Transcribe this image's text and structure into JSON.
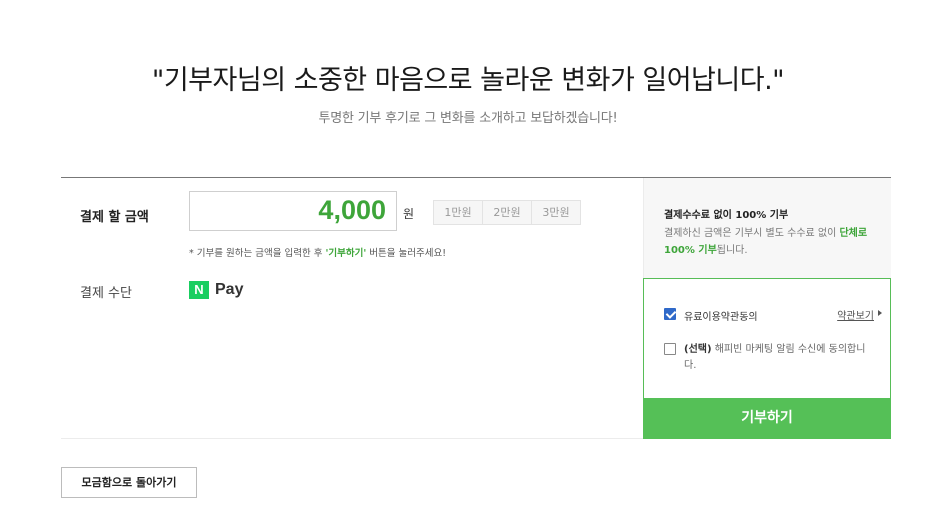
{
  "hero": {
    "title": "\"기부자님의 소중한 마음으로 놀라운 변화가 일어납니다.\"",
    "subtitle": "투명한 기부 후기로 그 변화를 소개하고 보답하겠습니다!"
  },
  "form": {
    "amount_label": "결제 할 금액",
    "amount_value": "4,000",
    "unit": "원",
    "quick_amounts": [
      "1만원",
      "2만원",
      "3만원"
    ],
    "hint_prefix": "* 기부를 원하는 금액을 입력한 후 ",
    "hint_highlight": "'기부하기'",
    "hint_suffix": " 버튼을 눌러주세요!",
    "method_label": "결제 수단",
    "method_logo_letter": "N",
    "method_logo_text": "Pay"
  },
  "fee": {
    "title": "결제수수료 없이 100% 기부",
    "desc_prefix": "결제하신 금액은 기부시 별도 수수료 없이 ",
    "desc_highlight": "단체로 100% 기부",
    "desc_suffix": "됩니다."
  },
  "agreements": {
    "terms_label": "유료이용약관동의",
    "terms_checked": true,
    "view_terms": "약관보기",
    "marketing_tag": "(선택)",
    "marketing_label": " 해피빈 마케팅 알림 수신에 동의합니다.",
    "marketing_checked": false
  },
  "donate_button": "기부하기",
  "back_button": "모금함으로 돌아가기",
  "colors": {
    "accent_green": "#3ea53a",
    "button_green": "#55c057",
    "npay_green": "#19ce60",
    "checkbox_blue": "#2f69c9"
  }
}
